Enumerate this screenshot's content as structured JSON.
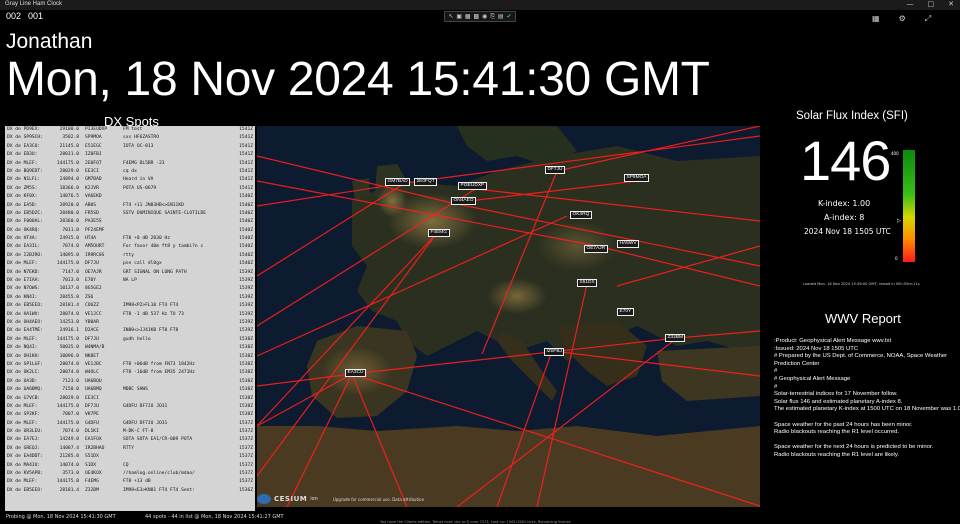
{
  "app": {
    "title": "Gray Line Ham Clock"
  },
  "counters": [
    "002",
    "001"
  ],
  "user_name": "Jonathan",
  "clock": "Mon, 18 Nov 2024 15:41:30 GMT",
  "toolbar_icons": [
    "pointer-icon",
    "window-icon",
    "image-icon",
    "photo-icon",
    "record-icon",
    "clip-icon",
    "chart-icon",
    "check-icon"
  ],
  "dx": {
    "title": "DX Spots",
    "rows": [
      [
        "DX de PD9EX:",
        "29100.0",
        "PI3EUDXP",
        "FM test",
        "1541Z"
      ],
      [
        "DX de SP9SCH:",
        "3502.8",
        "SP9MOA",
        "sxs HF6ZASTRO",
        "1541Z"
      ],
      [
        "DX de EA3CU:",
        "21145.0",
        "E51EGC",
        "IOTA OC-013",
        "1541Z"
      ],
      [
        "DX de EB3U:",
        "28031.0",
        "IZ0FBJ",
        "",
        "1541Z"
      ],
      [
        "DX de MLEF:",
        "144175.0",
        "2E0FQT",
        "F4EMG DL5BR -23",
        "1541Z"
      ],
      [
        "DX de BQ9EDT:",
        "28029.0",
        "EE3CI",
        "cq dx",
        "1541Z"
      ],
      [
        "DX de N1LFL:",
        "24894.0",
        "GM7BAD",
        "Heard in VA",
        "1541Z"
      ],
      [
        "DX de ZM5S:",
        "18366.0",
        "K2JVR",
        "POTA US-0679",
        "1541Z"
      ],
      [
        "DX de KF0X:",
        "14076.5",
        "VA6EKD",
        "",
        "1540Z"
      ],
      [
        "DX de EA5D:",
        "28920.0",
        "AB0S",
        "FT4 +11 JN03HB<>EN11KD",
        "1540Z"
      ],
      [
        "DX de EB5DZC:",
        "28480.0",
        "FR5SD",
        "SSTV DOMINIQUE SAINTE-CLOTILDE",
        "1540Z"
      ],
      [
        "DX de F000AL:",
        "28360.0",
        "PA3E5S",
        "",
        "1540Z"
      ],
      [
        "DX de OK4RQ:",
        "7011.0",
        "PF24EMF",
        "",
        "1540Z"
      ],
      [
        "DX de HT4A:",
        "24915.0",
        "HT4A",
        "FT8 +0 dB 2030 Hz",
        "1540Z"
      ],
      [
        "DX de EA3IL:",
        "7074.0",
        "AM5OURT",
        "For favor 40m ft8 y tambi?n c",
        "1540Z"
      ],
      [
        "DX de I2BJRO:",
        "14095.0",
        "IR9RC0S",
        "rtty",
        "1540Z"
      ],
      [
        "DX de MLEF:",
        "144175.0",
        "DF7JU",
        "pse call dl0gx",
        "1540Z"
      ],
      [
        "DX de N7EKD:",
        "7147.0",
        "OE7AJR",
        "GRT SIGNAL ON LONG PATH",
        "1539Z"
      ],
      [
        "DX de E7IAA:",
        "7013.0",
        "E70Y",
        "NA LP",
        "1539Z"
      ],
      [
        "DX de N7OWS:",
        "10137.0",
        "8G5GE2",
        "",
        "1539Z"
      ],
      [
        "DX de KN4I:",
        "28455.0",
        "ZS6",
        "",
        "1539Z"
      ],
      [
        "DX de EB5EEO:",
        "28181.4",
        "CO6ZZ",
        "IM98<P2>FL10 FT4 FT4",
        "1539Z"
      ],
      [
        "DX de HA1WV:",
        "28074.0",
        "VE1JCC",
        "FT8 -1 dB 537 Hz TU 73",
        "1539Z"
      ],
      [
        "DX de OH4AEO:",
        "14253.0",
        "YB0AR",
        "",
        "1539Z"
      ],
      [
        "DX de EA4TME:",
        "24916.1",
        "D2ACE",
        "IN80<>JJ41KB FT8 FT8",
        "1539Z"
      ],
      [
        "DX de MLEF:",
        "144175.0",
        "DF7JU",
        "gudh hello",
        "1538Z"
      ],
      [
        "DX de NQ4I:",
        "50035.0",
        "W4NMA/B",
        "",
        "1538Z"
      ],
      [
        "DX de OH1KH:",
        "10096.0",
        "NK8ET",
        "",
        "1538Z"
      ],
      [
        "DX de SP1LGF:",
        "28074.0",
        "VE1JBC",
        "FT8 +06dB from FN73 1842Hz",
        "1538Z"
      ],
      [
        "DX de OK2LC:",
        "28074.0",
        "W4OLC",
        "FT8 -16dB from EM35 2471Hz",
        "1538Z"
      ],
      [
        "DX de UA3D:",
        "7123.0",
        "UA6BQU",
        "",
        "1538Z"
      ],
      [
        "DX de UA6BMQ:",
        "7158.0",
        "UA6BMQ",
        "MDBC SHWS",
        "1538Z"
      ],
      [
        "DX de G7VCB:",
        "28029.0",
        "EE3CI",
        "",
        "1538Z"
      ],
      [
        "DX de MLEF:",
        "144175.0",
        "DF7JU",
        "G4DFU DF7JU JO31",
        "1538Z"
      ],
      [
        "DX de SP2KF:",
        "7007.0",
        "VK7PE",
        "",
        "1538Z"
      ],
      [
        "DX de MLEF:",
        "144175.0",
        "G4DFU",
        "G4DFU DF7JU JO31",
        "1537Z"
      ],
      [
        "DX de UR3LEU:",
        "7074.0",
        "DL1KI",
        "M-DK-C  FT-8",
        "1537Z"
      ],
      [
        "DX de EA7EJ:",
        "14249.0",
        "EA1FOX",
        "SOTA  SOTA EA1/CR-009  POTA",
        "1537Z"
      ],
      [
        "DX de GREQJ:",
        "14087.4",
        "IR2BHAO",
        "RTTY",
        "1537Z"
      ],
      [
        "DX de EA4DDT:",
        "21285.0",
        "S51DX",
        "",
        "1537Z"
      ],
      [
        "DX de MA4JU:",
        "14074.0",
        "S1DX",
        "CQ",
        "1537Z"
      ],
      [
        "DX de KV5APB:",
        "3573.0",
        "OE4KOX",
        "//hamlog.online/club/mdao/",
        "1537Z"
      ],
      [
        "DX de MLEF:",
        "144175.0",
        "F4EMG",
        "FT8 +13 dB",
        "1537Z"
      ],
      [
        "DX de EB5EEO:",
        "28181.4",
        "Z32BM",
        "IM98<E3>KN01 FT4 FT4  Sent:",
        "1536Z"
      ]
    ]
  },
  "status": {
    "left": "Probing @ Mon, 18 Nov 2024 15:41:30 GMT",
    "mid": "44 spots - 44 in list @ Mon, 18 Nov 2024 15:41:27 GMT",
    "footer": "You have the Clients edition. Telnet host: dxc.nc7j.com:7373, Last run 1561/1561 ticks, Remaining license"
  },
  "map": {
    "credit": "CESIUM",
    "credit_sub": "ion",
    "attribution": "Upgrade for commercial use.  Data attribution",
    "labels": [
      {
        "text": "GM7BAD",
        "pos": "l1"
      },
      {
        "text": "2E0FQT",
        "pos": "l2"
      },
      {
        "text": "PI3EUDXP",
        "pos": "l3"
      },
      {
        "text": "ON4AEO",
        "pos": "l4"
      },
      {
        "text": "DF7JU",
        "pos": "l5"
      },
      {
        "text": "SP9MOA",
        "pos": "l6"
      },
      {
        "text": "OK4RQ",
        "pos": "l7"
      },
      {
        "text": "F4EMG",
        "pos": "l8"
      },
      {
        "text": "OE7AJR",
        "pos": "l9"
      },
      {
        "text": "HA5WV",
        "pos": "l10"
      },
      {
        "text": "S51DX",
        "pos": "l11"
      },
      {
        "text": "E70Y",
        "pos": "l12"
      },
      {
        "text": "Z32BM",
        "pos": "l13"
      },
      {
        "text": "IZ0FBJ",
        "pos": "l14"
      },
      {
        "text": "EA3CU",
        "pos": "l15"
      }
    ]
  },
  "sfi": {
    "title": "Solar Flux Index (SFI)",
    "value": "146",
    "bar_max": "400",
    "bar_min": "0",
    "bar_level_fraction": 0.365,
    "k_index": "K-index:  1.00",
    "a_index": "A-index:  8",
    "time": "2024 Nov 18 1505 UTC",
    "loaded": "Loaded Mon, 18 Nov 2024 15:36:00 GMT, reload in 00h:05m:11s",
    "colors": {
      "top": "#0b8a0b",
      "mid": "#d6d600",
      "bottom": "#ff1a1a"
    }
  },
  "wwv": {
    "title": "WWV Report",
    "lines": [
      ":Product: Geophysical Alert Message wwv.txt",
      ":Issued: 2024 Nov 18 1505 UTC",
      "# Prepared by the US Dept. of Commerce, NOAA, Space Weather",
      "Prediction Center",
      "#",
      "#          Geophysical Alert Message",
      "#",
      "Solar-terrestrial indices for 17 November follow.",
      "Solar flux 146 and estimated planetary A-index 8.",
      "The estimated planetary K-index at 1500 UTC on 18 November was 1.00.",
      "",
      "Space weather for the past 24 hours has been minor.",
      "Radio blackouts reaching the R1 level occurred.",
      "",
      "Space weather for the next 24 hours is predicted to be minor.",
      "Radio blackouts reaching the R1 level are likely."
    ]
  }
}
